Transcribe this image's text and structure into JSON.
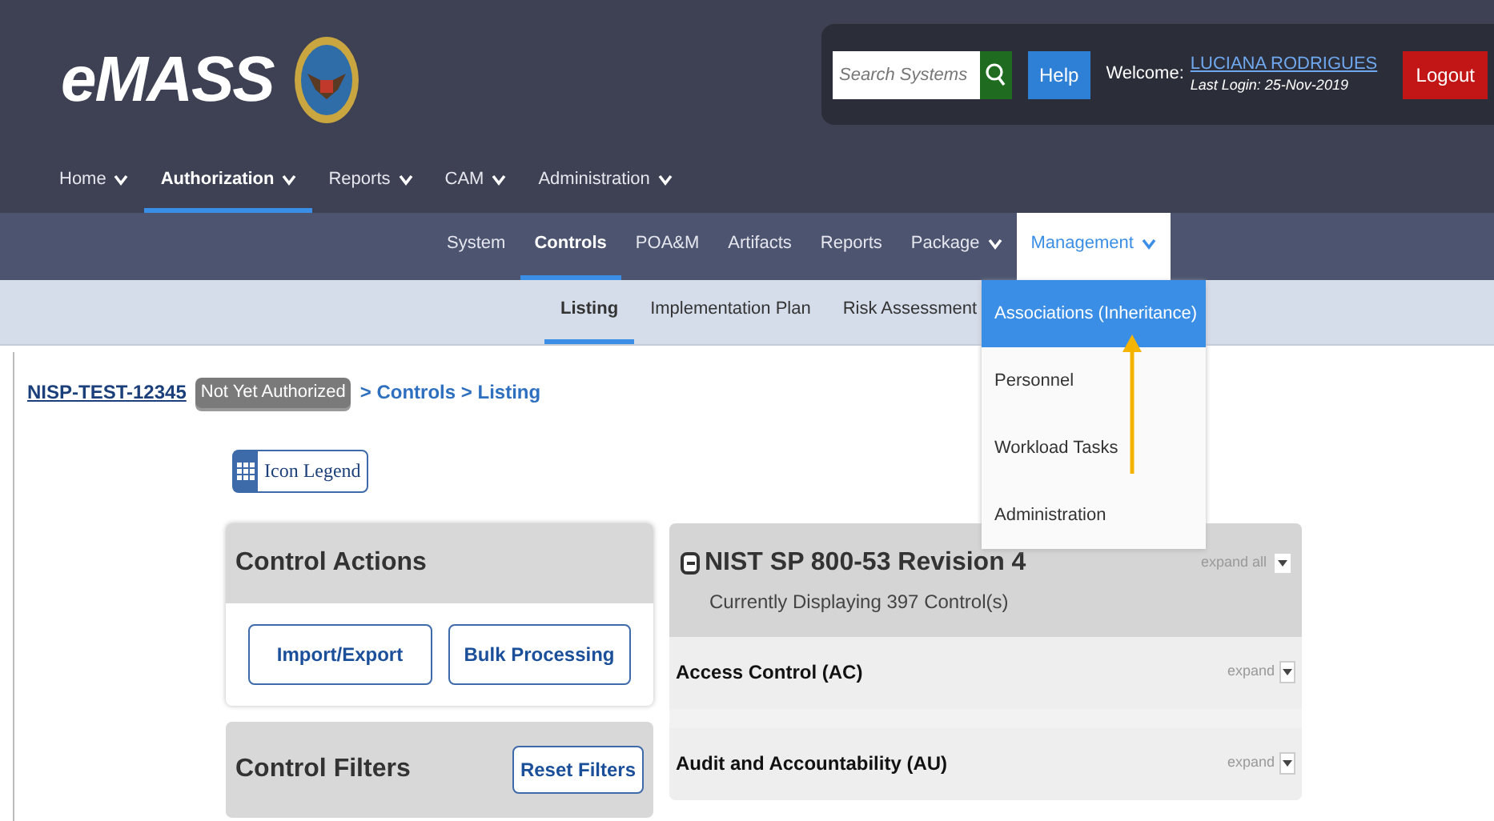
{
  "header": {
    "logo": "eMASS",
    "search": {
      "placeholder": "Search Systems"
    },
    "help": "Help",
    "welcome": "Welcome:",
    "user": "LUCIANA RODRIGUES",
    "last_login": "Last Login: 25-Nov-2019",
    "logout": "Logout"
  },
  "main_nav": [
    {
      "label": "Home",
      "selected": false,
      "dropdown": true
    },
    {
      "label": "Authorization",
      "selected": true,
      "dropdown": true
    },
    {
      "label": "Reports",
      "selected": false,
      "dropdown": true
    },
    {
      "label": "CAM",
      "selected": false,
      "dropdown": true
    },
    {
      "label": "Administration",
      "selected": false,
      "dropdown": true
    }
  ],
  "sub_nav": [
    {
      "label": "System",
      "selected": false,
      "dropdown": false,
      "open": false
    },
    {
      "label": "Controls",
      "selected": true,
      "dropdown": false,
      "open": false
    },
    {
      "label": "POA&M",
      "selected": false,
      "dropdown": false,
      "open": false
    },
    {
      "label": "Artifacts",
      "selected": false,
      "dropdown": false,
      "open": false
    },
    {
      "label": "Reports",
      "selected": false,
      "dropdown": false,
      "open": false
    },
    {
      "label": "Package",
      "selected": false,
      "dropdown": true,
      "open": false
    },
    {
      "label": "Management",
      "selected": false,
      "dropdown": true,
      "open": true
    }
  ],
  "third_nav": [
    {
      "label": "Listing",
      "selected": true
    },
    {
      "label": "Implementation Plan",
      "selected": false
    },
    {
      "label": "Risk Assessment",
      "selected": false
    }
  ],
  "management_menu": [
    {
      "label": "Associations (Inheritance)",
      "selected": true
    },
    {
      "label": "Personnel",
      "selected": false
    },
    {
      "label": "Workload Tasks",
      "selected": false
    },
    {
      "label": "Administration",
      "selected": false
    }
  ],
  "breadcrumb": {
    "system": "NISP-TEST-12345",
    "status": "Not Yet Authorized",
    "trail": "> Controls > Listing"
  },
  "icon_legend": "Icon Legend",
  "control_actions": {
    "title": "Control Actions",
    "buttons": [
      "Import/Export",
      "Bulk Processing"
    ]
  },
  "control_filters": {
    "title": "Control Filters",
    "reset": "Reset Filters"
  },
  "framework": {
    "title": "NIST SP 800-53 Revision 4",
    "subtitle": "Currently Displaying 397 Control(s)",
    "expand_all": "expand all",
    "families": [
      {
        "name": "Access Control (AC)",
        "expand": "expand"
      },
      {
        "name": "Audit and Accountability (AU)",
        "expand": "expand"
      }
    ]
  }
}
